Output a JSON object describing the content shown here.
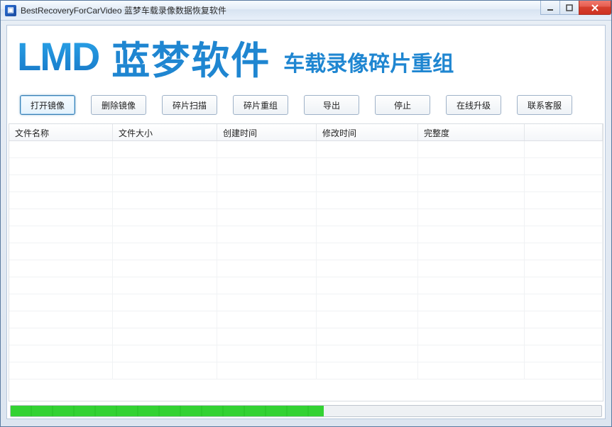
{
  "window": {
    "title": "BestRecoveryForCarVideo  蓝梦车载录像数据恢复软件"
  },
  "banner": {
    "logo": "LMD",
    "cn": "蓝梦软件",
    "sub": "车载录像碎片重组"
  },
  "toolbar": {
    "open_image": "打开镜像",
    "delete_image": "删除镜像",
    "scan_fragments": "碎片扫描",
    "reassemble": "碎片重组",
    "export": "导出",
    "stop": "停止",
    "online_upgrade": "在线升级",
    "contact": "联系客服"
  },
  "columns": {
    "filename": "文件名称",
    "filesize": "文件大小",
    "created": "创建时间",
    "modified": "修改时间",
    "integrity": "完整度"
  },
  "rows": [],
  "empty_row_count": 14,
  "progress_percent": 53
}
